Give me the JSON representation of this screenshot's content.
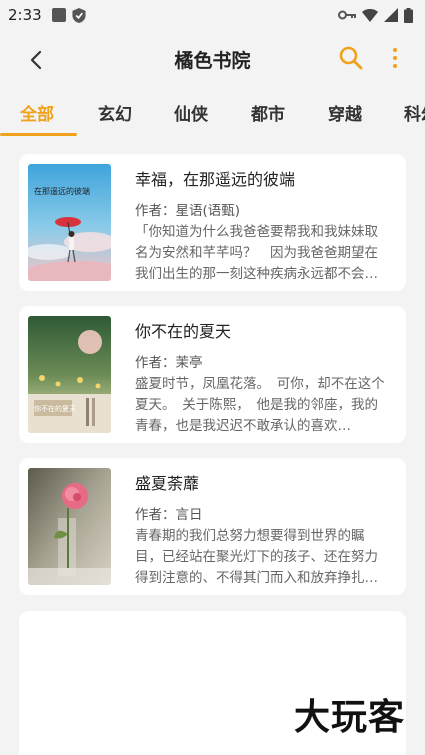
{
  "status_bar": {
    "time": "2:33"
  },
  "app_bar": {
    "title": "橘色书院"
  },
  "tabs": [
    {
      "label": "全部"
    },
    {
      "label": "玄幻"
    },
    {
      "label": "仙侠"
    },
    {
      "label": "都市"
    },
    {
      "label": "穿越"
    },
    {
      "label": "科幻"
    }
  ],
  "books": [
    {
      "title": "幸福，在那遥远的彼端",
      "author": "作者：星语(语甄)",
      "description": "「你知道为什么我爸爸要帮我和我妹妹取名为安然和芊芊吗？　因为我爸爸期望在我们出生的那一刻这种疾病永远都不会…",
      "cover_text": "在那遥远的彼端"
    },
    {
      "title": "你不在的夏天",
      "author": "作者：茉亭",
      "description": "盛夏时节，凤凰花落。　可你，却不在这个夏天。　关于陈熙，　他是我的邻座，我的青春，也是我迟迟不敢承认的喜欢…",
      "cover_text": "你不在的夏天"
    },
    {
      "title": "盛夏荼蘼",
      "author": "作者：言日",
      "description": "青春期的我们总努力想要得到世界的瞩目，已经站在聚光灯下的孩子、还在努力得到注意的、不得其门而入和放弃挣扎…"
    }
  ],
  "watermark": "大玩客",
  "colors": {
    "accent": "#f0a21c",
    "background": "#f3f3f3"
  }
}
